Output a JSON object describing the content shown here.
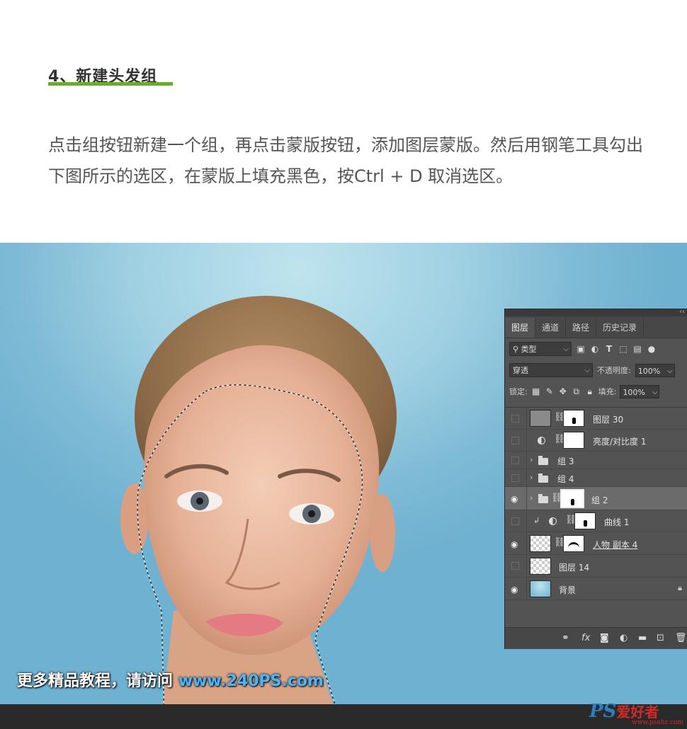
{
  "heading": "4、新建头发组",
  "paragraph": "点击组按钮新建一个组，再点击蒙版按钮，添加图层蒙版。然后用钢笔工具勾出下图所示的选区，在蒙版上填充黑色，按Ctrl + D 取消选区。",
  "colors": {
    "accent": "#6aad2a",
    "panel_bg": "#535353",
    "watermark_url": "#47b8ff"
  },
  "panel": {
    "tabs": [
      "图层",
      "通道",
      "路径",
      "历史记录"
    ],
    "filter_label": "类型",
    "blend_mode": "穿透",
    "opacity_label": "不透明度:",
    "opacity_value": "100%",
    "lock_label": "锁定:",
    "fill_label": "填充:",
    "fill_value": "100%",
    "layers": [
      {
        "name": "图层 30",
        "visible": false
      },
      {
        "name": "亮度/对比度 1",
        "visible": false
      },
      {
        "name": "组 3",
        "visible": false
      },
      {
        "name": "组 4",
        "visible": false
      },
      {
        "name": "组 2",
        "visible": true,
        "selected": true
      },
      {
        "name": "曲线 1",
        "visible": false
      },
      {
        "name": "人物 副本 4",
        "visible": true
      },
      {
        "name": "图层 14",
        "visible": false
      },
      {
        "name": "背景",
        "visible": true
      }
    ]
  },
  "watermark": {
    "text": "更多精品教程，请访问",
    "url": "www.240PS.com"
  },
  "logo": {
    "brand": "PS",
    "cn": "爱好者",
    "url": "www.psahz.com"
  }
}
